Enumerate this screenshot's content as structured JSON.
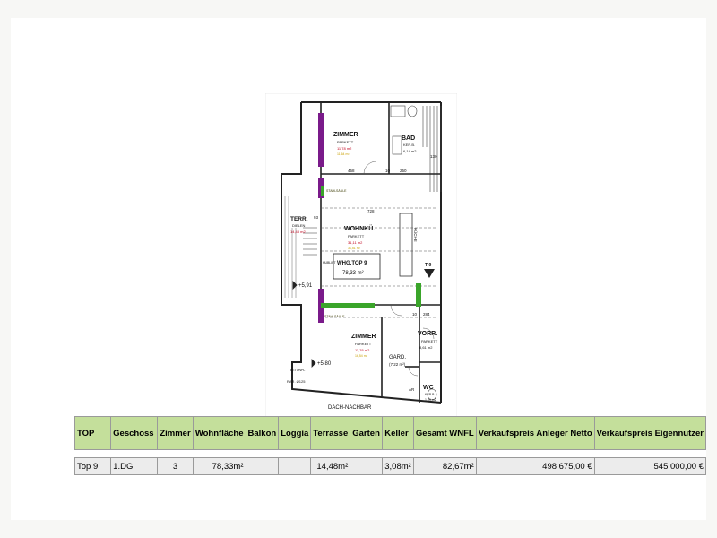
{
  "plan": {
    "rooms": {
      "zimmer_top": {
        "name": "ZIMMER",
        "floor": "PARKETT",
        "area": "11,78 m2",
        "area_alt": "11,64 m²"
      },
      "bad": {
        "name": "BAD",
        "floor": "KER.B.",
        "area": "6,14 m2"
      },
      "wohnkue": {
        "name": "WOHNKÜ.",
        "floor": "PARKETT",
        "area": "31,11 m2",
        "area_alt": "31,51 m²"
      },
      "terr": {
        "name": "TERR.",
        "floor": "DIELEN",
        "area": "14,48 m2"
      },
      "zimmer_bottom": {
        "name": "ZIMMER",
        "floor": "PARKETT",
        "area": "11,76 m2",
        "area_alt": "16,54 m²"
      },
      "gard": {
        "name": "GARD.",
        "area": "(7,22 m²)"
      },
      "vorr": {
        "name": "VORR.",
        "floor": "PARKETT",
        "area": "8,61 m2"
      },
      "wc": {
        "name": "WC",
        "floor": "KER.B.",
        "area": "1,99 m2"
      },
      "ar": {
        "name": "AR"
      }
    },
    "unit": {
      "title": "WHG.TOP 9",
      "area": "78,33 m²"
    },
    "labels": {
      "kueche": "KÜCHE",
      "top_marker": "T 9",
      "level_upper": "+5,91",
      "level_lower": "+5,80",
      "dach_nachbar": "DACH-NACHBAR",
      "stahlsaeule_upper": "STAHLSÄULE",
      "stahlsaeule_lower": "STAHLSÄULE",
      "hublift": "HUBLIFT",
      "betonpl": "BETONPL",
      "rar": "RAR. Ø125"
    },
    "dims": {
      "d458": "458",
      "d10a": "10",
      "d250": "250",
      "d728": "728",
      "d10b": "10",
      "d284": "284",
      "d130": "130",
      "d93": "93"
    }
  },
  "table": {
    "headers": [
      "TOP",
      "Geschoss",
      "Zimmer",
      "Wohnfläche",
      "Balkon",
      "Loggia",
      "Terrasse",
      "Garten",
      "Keller",
      "Gesamt WNFL",
      "Verkaufspreis Anleger Netto",
      "Verkaufspreis Eigennutzer"
    ],
    "row": {
      "top": "Top 9",
      "geschoss": "1.DG",
      "zimmer": "3",
      "wohnflaeche": "78,33m²",
      "balkon": "",
      "loggia": "",
      "terrasse": "14,48m²",
      "garten": "",
      "keller": "3,08m²",
      "gesamt": "82,67m²",
      "anleger": "498 675,00 €",
      "eigennutzer": "545 000,00 €"
    }
  }
}
